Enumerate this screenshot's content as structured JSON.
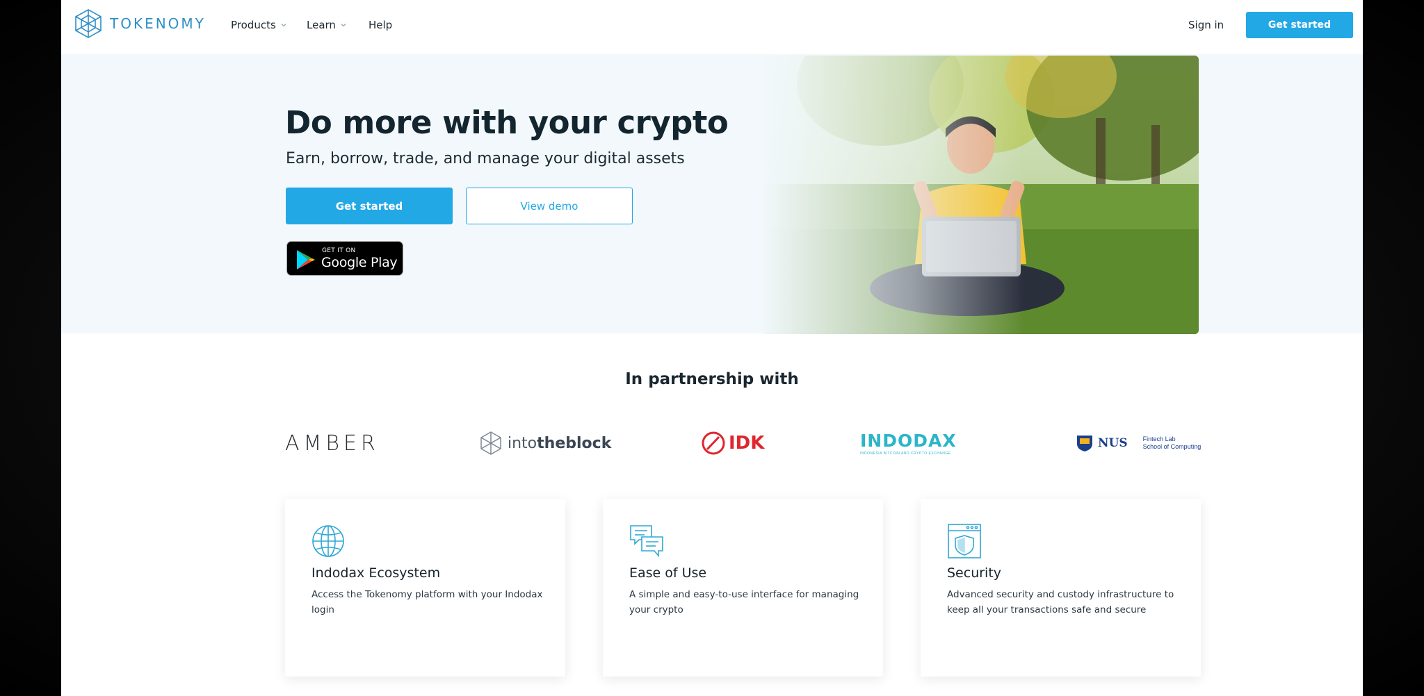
{
  "brand": {
    "name": "TOKENOMY",
    "accent": "#23a8e6",
    "logo_color": "#2f8fc6"
  },
  "nav": {
    "items": [
      {
        "label": "Products",
        "has_dropdown": true
      },
      {
        "label": "Learn",
        "has_dropdown": true
      },
      {
        "label": "Help",
        "has_dropdown": false
      }
    ],
    "sign_in": "Sign in",
    "cta": "Get started"
  },
  "hero": {
    "title": "Do more with your crypto",
    "subtitle": "Earn, borrow, trade, and manage your digital assets",
    "primary_button": "Get started",
    "secondary_button": "View demo",
    "store_badge": {
      "small": "GET IT ON",
      "big": "Google Play"
    },
    "image_icon": "person-with-laptop-photo"
  },
  "partners": {
    "title": "In partnership with",
    "logos": [
      {
        "name": "AMBER"
      },
      {
        "name": "intotheblock",
        "light": "into",
        "bold": "theblock"
      },
      {
        "name": "IDK"
      },
      {
        "name": "INDODAX",
        "tagline": "INDONESIA BITCOIN AND CRYPTO EXCHANGE"
      },
      {
        "name": "NUS",
        "sub_line1": "Fintech Lab",
        "sub_line2": "School of Computing"
      }
    ]
  },
  "features": [
    {
      "icon": "globe-icon",
      "title": "Indodax Ecosystem",
      "desc": "Access the Tokenomy platform with your Indodax login"
    },
    {
      "icon": "chat-bubbles-icon",
      "title": "Ease of Use",
      "desc": "A simple and easy-to-use interface for managing your crypto"
    },
    {
      "icon": "shield-window-icon",
      "title": "Security",
      "desc": "Advanced security and custody infrastructure to keep all your transactions safe and secure"
    }
  ]
}
